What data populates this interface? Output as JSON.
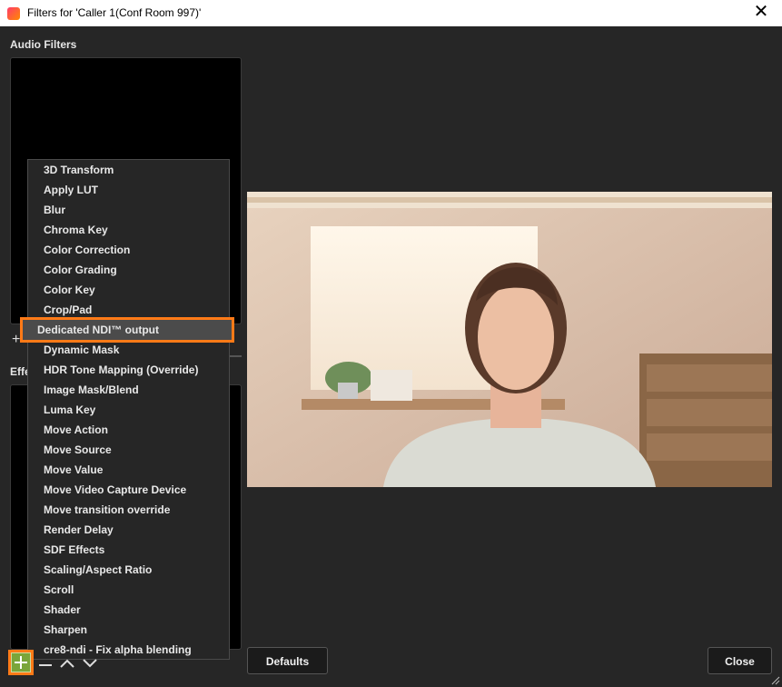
{
  "window": {
    "title": "Filters for 'Caller 1(Conf Room 997)'"
  },
  "audio_filters": {
    "label": "Audio Filters"
  },
  "effect_filters": {
    "label": "Effe"
  },
  "menu": {
    "items": [
      "3D Transform",
      "Apply LUT",
      "Blur",
      "Chroma Key",
      "Color Correction",
      "Color Grading",
      "Color Key",
      "Crop/Pad",
      "Dedicated NDI™ output",
      "Dynamic Mask",
      "HDR Tone Mapping (Override)",
      "Image Mask/Blend",
      "Luma Key",
      "Move Action",
      "Move Source",
      "Move Value",
      "Move Video Capture Device",
      "Move transition override",
      "Render Delay",
      "SDF Effects",
      "Scaling/Aspect Ratio",
      "Scroll",
      "Shader",
      "Sharpen",
      "cre8-ndi - Fix alpha blending"
    ],
    "selected": "Dedicated NDI™ output"
  },
  "buttons": {
    "defaults": "Defaults",
    "close": "Close"
  },
  "colors": {
    "highlight": "#ff7a17",
    "background": "#262626",
    "list_bg": "#000000"
  },
  "icons": {
    "add": "plus-icon",
    "remove": "minus-icon",
    "up": "chevron-up-icon",
    "down": "chevron-down-icon",
    "close": "close-icon"
  }
}
